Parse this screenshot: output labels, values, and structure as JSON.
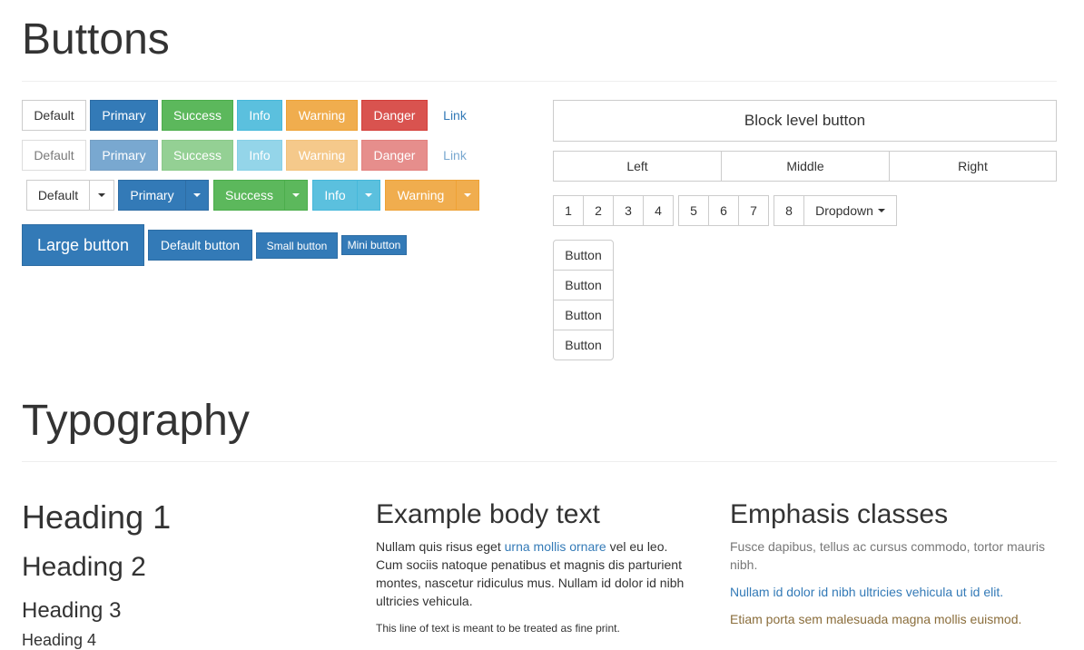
{
  "buttons_section": {
    "title": "Buttons"
  },
  "row1": [
    "Default",
    "Primary",
    "Success",
    "Info",
    "Warning",
    "Danger",
    "Link"
  ],
  "row2": [
    "Default",
    "Primary",
    "Success",
    "Info",
    "Warning",
    "Danger",
    "Link"
  ],
  "split_row": [
    "Default",
    "Primary",
    "Success",
    "Info",
    "Warning"
  ],
  "sizes": {
    "large": "Large button",
    "default": "Default button",
    "small": "Small button",
    "mini": "Mini button"
  },
  "block_button": "Block level button",
  "justified": [
    "Left",
    "Middle",
    "Right"
  ],
  "pagination": {
    "group1": [
      "1",
      "2",
      "3",
      "4"
    ],
    "group2": [
      "5",
      "6",
      "7"
    ],
    "group3": [
      "8"
    ],
    "dropdown": "Dropdown"
  },
  "vertical_group": [
    "Button",
    "Button",
    "Button",
    "Button"
  ],
  "typography_section": {
    "title": "Typography"
  },
  "headings": {
    "h1": "Heading 1",
    "h2": "Heading 2",
    "h3": "Heading 3",
    "h4": "Heading 4"
  },
  "body_text": {
    "title": "Example body text",
    "p1_before": "Nullam quis risus eget ",
    "p1_link": "urna mollis ornare",
    "p1_after": " vel eu leo. Cum sociis natoque penatibus et magnis dis parturient montes, nascetur ridiculus mus. Nullam id dolor id nibh ultricies vehicula.",
    "fine_print": "This line of text is meant to be treated as fine print."
  },
  "emphasis": {
    "title": "Emphasis classes",
    "muted": "Fusce dapibus, tellus ac cursus commodo, tortor mauris nibh.",
    "primary": "Nullam id dolor id nibh ultricies vehicula ut id elit.",
    "warning": "Etiam porta sem malesuada magna mollis euismod."
  },
  "colors": {
    "primary": "#337ab7",
    "success": "#5cb85c",
    "info": "#5bc0de",
    "warning": "#f0ad4e",
    "danger": "#d9534f",
    "muted": "#777777",
    "warning_text": "#8a6d3b"
  }
}
